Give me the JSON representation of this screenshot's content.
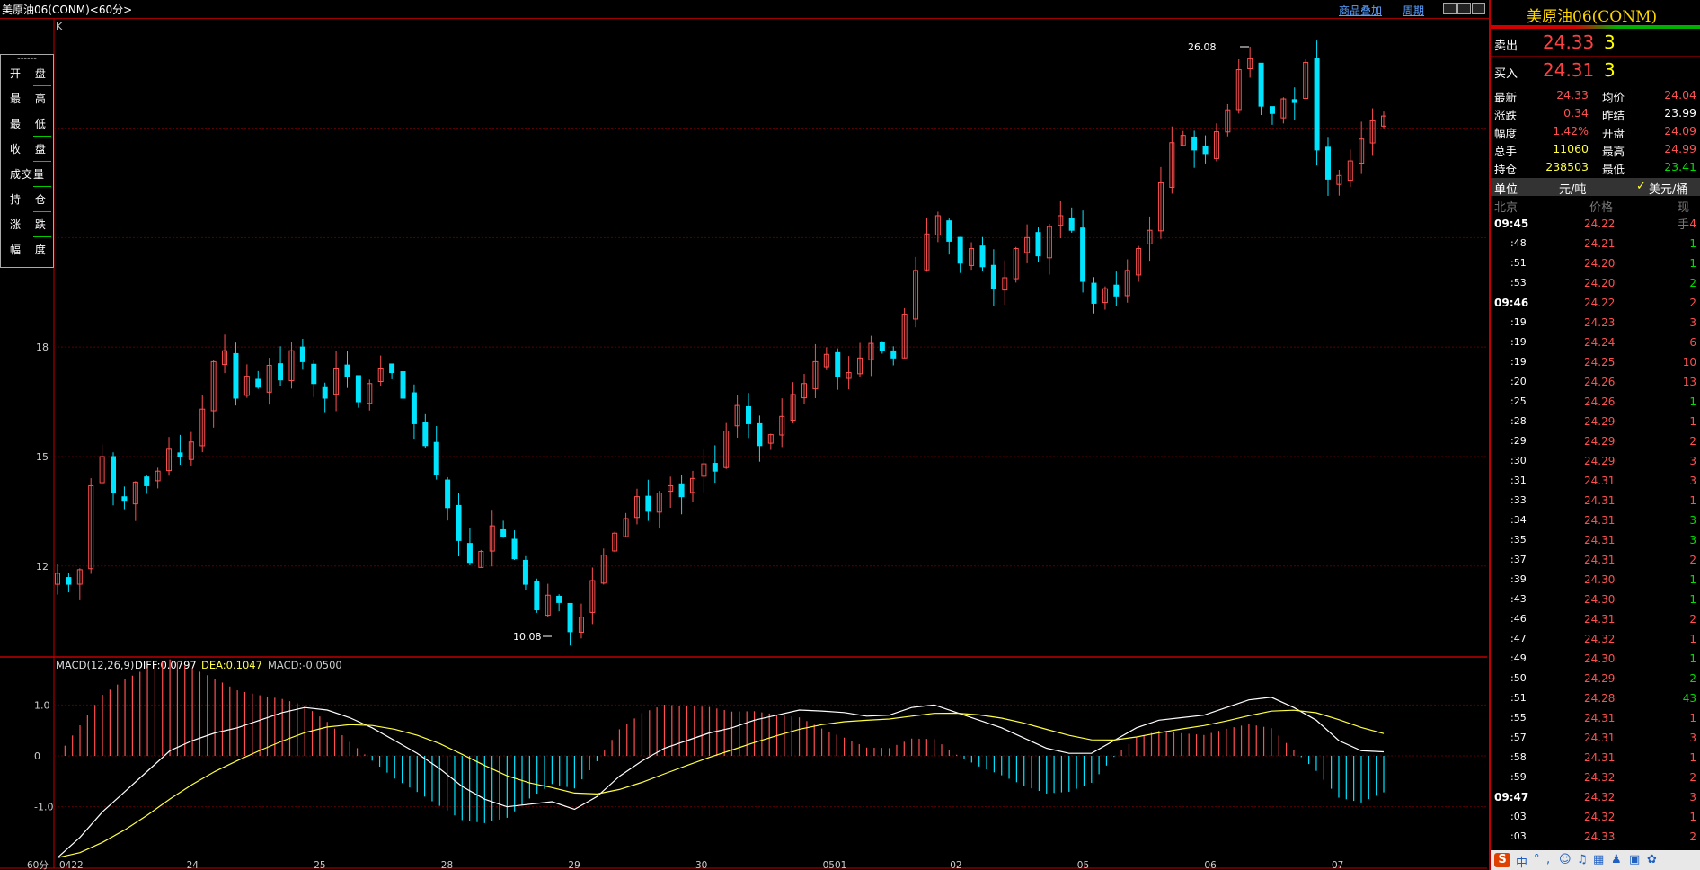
{
  "title": "美原油06(CONM)<60分>",
  "header_links": [
    "商品叠加",
    "周期"
  ],
  "chart_label": "K",
  "ohlc_labels": [
    "开 盘",
    "最 高",
    "最 低",
    "收 盘",
    "成交量",
    "持 仓",
    "涨 跌",
    "幅 度"
  ],
  "ohlc_dash": "------",
  "peak_label": "26.08",
  "low_label": "10.08",
  "macd": {
    "title": "MACD(12,26,9)",
    "diff": "DIFF:0.0797",
    "dea": "DEA:0.1047",
    "macd": "MACD:-0.0500"
  },
  "colors": {
    "up": "#ff5050",
    "down": "#00e5ff",
    "grid": "#5a0000",
    "diff": "#ffffff",
    "dea": "#ffff40"
  },
  "chart_data": {
    "type": "candlestick",
    "ylabels": [
      "18",
      "15",
      "12"
    ],
    "y_ticks": [
      18,
      15,
      12
    ],
    "price_range": [
      10.0,
      26.5
    ],
    "x_labels": [
      "0422",
      "24",
      "25",
      "28",
      "29",
      "30",
      "0501",
      "02",
      "05",
      "06",
      "07"
    ],
    "x_label_first": "60分",
    "macd_yticks": [
      "1.0",
      "0",
      "-1.0"
    ],
    "macd_ytick_values": [
      1.0,
      0,
      -1.0
    ],
    "macd_range": [
      -2.1,
      1.5
    ],
    "close_path": [
      11.8,
      11.5,
      11.9,
      14.2,
      15.0,
      14.0,
      13.8,
      14.3,
      14.2,
      14.6,
      15.2,
      15.0,
      15.4,
      16.3,
      17.6,
      17.9,
      16.6,
      17.2,
      16.9,
      17.5,
      17.1,
      17.9,
      17.6,
      17.0,
      16.6,
      17.4,
      17.2,
      16.5,
      17.0,
      17.4,
      17.3,
      16.6,
      15.9,
      15.3,
      14.5,
      13.6,
      12.7,
      12.1,
      12.4,
      13.1,
      12.8,
      12.2,
      11.5,
      10.8,
      11.2,
      11.0,
      10.2,
      10.6,
      11.6,
      12.3,
      12.9,
      13.3,
      13.9,
      13.5,
      14.0,
      14.2,
      13.9,
      14.4,
      14.8,
      14.6,
      15.7,
      16.4,
      15.9,
      15.3,
      15.6,
      16.1,
      16.7,
      17.0,
      17.6,
      17.8,
      17.2,
      17.3,
      17.7,
      18.1,
      17.9,
      17.7,
      18.9,
      20.1,
      21.1,
      21.6,
      20.9,
      20.3,
      20.7,
      20.2,
      19.6,
      19.9,
      20.7,
      21.0,
      20.5,
      21.3,
      21.6,
      21.2,
      19.8,
      19.2,
      19.6,
      19.4,
      20.1,
      20.7,
      21.2,
      22.5,
      23.6,
      23.8,
      23.4,
      23.3,
      23.9,
      24.5,
      25.6,
      25.9,
      24.6,
      24.4,
      24.8,
      24.7,
      25.8,
      23.4,
      22.6,
      22.7,
      23.1,
      23.7,
      24.2,
      24.33
    ],
    "macd_diff": [
      -2.0,
      -1.6,
      -1.1,
      -0.7,
      -0.3,
      0.1,
      0.3,
      0.45,
      0.55,
      0.7,
      0.85,
      0.95,
      0.9,
      0.75,
      0.55,
      0.3,
      0.05,
      -0.25,
      -0.6,
      -0.85,
      -1.0,
      -0.95,
      -0.9,
      -1.05,
      -0.8,
      -0.4,
      -0.1,
      0.15,
      0.3,
      0.45,
      0.55,
      0.7,
      0.8,
      0.9,
      0.88,
      0.85,
      0.78,
      0.8,
      0.95,
      1.0,
      0.85,
      0.7,
      0.55,
      0.35,
      0.15,
      0.05,
      0.05,
      0.3,
      0.55,
      0.7,
      0.75,
      0.8,
      0.95,
      1.1,
      1.15,
      0.95,
      0.7,
      0.3,
      0.1,
      0.08
    ]
  },
  "side": {
    "name": "美原油06(CONM)",
    "sell_label": "卖出",
    "sell_price": "24.33",
    "sell_vol": "3",
    "buy_label": "买入",
    "buy_price": "24.31",
    "buy_vol": "3",
    "quotes": [
      {
        "l1": "最新",
        "v1": "24.33",
        "l2": "均价",
        "v2": "24.04",
        "c1": "#ff5050",
        "c2": "#ff5050"
      },
      {
        "l1": "涨跌",
        "v1": "0.34",
        "l2": "昨结",
        "v2": "23.99",
        "c1": "#ff5050",
        "c2": "#ffffff"
      },
      {
        "l1": "幅度",
        "v1": "1.42%",
        "l2": "开盘",
        "v2": "24.09",
        "c1": "#ff5050",
        "c2": "#ff5050"
      },
      {
        "l1": "总手",
        "v1": "11060",
        "l2": "最高",
        "v2": "24.99",
        "c1": "#ffff40",
        "c2": "#ff5050"
      },
      {
        "l1": "持仓",
        "v1": "238503",
        "l2": "最低",
        "v2": "23.41",
        "c1": "#ffff40",
        "c2": "#00e000"
      }
    ],
    "unit_label": "单位",
    "unit_value": "元/吨",
    "unit_alt": "美元/桶",
    "tick_headers": [
      "北京",
      "价格",
      "现手"
    ],
    "ticks": [
      {
        "t": "09:45",
        "p": "24.22",
        "v": "4",
        "major": true,
        "vc": "#ff5050"
      },
      {
        "t": ":48",
        "p": "24.21",
        "v": "1",
        "vc": "#00e000"
      },
      {
        "t": ":51",
        "p": "24.20",
        "v": "1",
        "vc": "#00e000"
      },
      {
        "t": ":53",
        "p": "24.20",
        "v": "2",
        "vc": "#00e000"
      },
      {
        "t": "09:46",
        "p": "24.22",
        "v": "2",
        "major": true,
        "vc": "#ff5050"
      },
      {
        "t": ":19",
        "p": "24.23",
        "v": "3",
        "vc": "#ff5050"
      },
      {
        "t": ":19",
        "p": "24.24",
        "v": "6",
        "vc": "#ff5050"
      },
      {
        "t": ":19",
        "p": "24.25",
        "v": "10",
        "vc": "#ff5050"
      },
      {
        "t": ":20",
        "p": "24.26",
        "v": "13",
        "vc": "#ff5050"
      },
      {
        "t": ":25",
        "p": "24.26",
        "v": "1",
        "vc": "#00e000"
      },
      {
        "t": ":28",
        "p": "24.29",
        "v": "1",
        "vc": "#ff5050"
      },
      {
        "t": ":29",
        "p": "24.29",
        "v": "2",
        "vc": "#ff5050"
      },
      {
        "t": ":30",
        "p": "24.29",
        "v": "3",
        "vc": "#ff5050"
      },
      {
        "t": ":31",
        "p": "24.31",
        "v": "3",
        "vc": "#ff5050"
      },
      {
        "t": ":33",
        "p": "24.31",
        "v": "1",
        "vc": "#ff5050"
      },
      {
        "t": ":34",
        "p": "24.31",
        "v": "3",
        "vc": "#00e000"
      },
      {
        "t": ":35",
        "p": "24.31",
        "v": "3",
        "vc": "#00e000"
      },
      {
        "t": ":37",
        "p": "24.31",
        "v": "2",
        "vc": "#ff5050"
      },
      {
        "t": ":39",
        "p": "24.30",
        "v": "1",
        "vc": "#00e000"
      },
      {
        "t": ":43",
        "p": "24.30",
        "v": "1",
        "vc": "#00e000"
      },
      {
        "t": ":46",
        "p": "24.31",
        "v": "2",
        "vc": "#ff5050"
      },
      {
        "t": ":47",
        "p": "24.32",
        "v": "1",
        "vc": "#ff5050"
      },
      {
        "t": ":49",
        "p": "24.30",
        "v": "1",
        "vc": "#00e000"
      },
      {
        "t": ":50",
        "p": "24.29",
        "v": "2",
        "vc": "#00e000"
      },
      {
        "t": ":51",
        "p": "24.28",
        "v": "43",
        "vc": "#00e000"
      },
      {
        "t": ":55",
        "p": "24.31",
        "v": "1",
        "vc": "#ff5050"
      },
      {
        "t": ":57",
        "p": "24.31",
        "v": "3",
        "vc": "#ff5050"
      },
      {
        "t": ":58",
        "p": "24.31",
        "v": "1",
        "vc": "#ff5050"
      },
      {
        "t": ":59",
        "p": "24.32",
        "v": "2",
        "vc": "#ff5050"
      },
      {
        "t": "09:47",
        "p": "24.32",
        "v": "3",
        "major": true,
        "vc": "#ff5050"
      },
      {
        "t": ":03",
        "p": "24.32",
        "v": "1",
        "vc": "#ff5050"
      },
      {
        "t": ":03",
        "p": "24.33",
        "v": "2",
        "vc": "#ff5050"
      }
    ],
    "taskbar": [
      "中",
      "°",
      ",",
      "☺",
      "♫",
      "▦",
      "♟",
      "▣",
      "✿"
    ]
  }
}
